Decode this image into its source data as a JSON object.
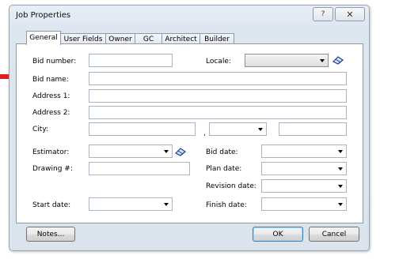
{
  "window": {
    "title": "Job Properties",
    "help_label": "?",
    "close_label": "✕"
  },
  "tabs": [
    {
      "label": "General",
      "active": true
    },
    {
      "label": "User Fields"
    },
    {
      "label": "Owner"
    },
    {
      "label": "GC"
    },
    {
      "label": "Architect"
    },
    {
      "label": "Builder"
    }
  ],
  "form": {
    "bid_number": {
      "label": "Bid number:",
      "value": ""
    },
    "locale": {
      "label": "Locale:",
      "value": ""
    },
    "bid_name": {
      "label": "Bid name:",
      "value": ""
    },
    "address1": {
      "label": "Address 1:",
      "value": ""
    },
    "address2": {
      "label": "Address 2:",
      "value": ""
    },
    "city": {
      "label": "City:",
      "value": "",
      "state": "",
      "zip": "",
      "separator": ","
    },
    "estimator": {
      "label": "Estimator:",
      "value": ""
    },
    "drawing": {
      "label": "Drawing #:",
      "value": ""
    },
    "bid_date": {
      "label": "Bid date:",
      "value": ""
    },
    "plan_date": {
      "label": "Plan date:",
      "value": ""
    },
    "revision_date": {
      "label": "Revision date:",
      "value": ""
    },
    "start_date": {
      "label": "Start date:",
      "value": ""
    },
    "finish_date": {
      "label": "Finish date:",
      "value": ""
    }
  },
  "buttons": {
    "notes": "Notes...",
    "ok": "OK",
    "cancel": "Cancel"
  },
  "colors": {
    "callout_arrow": "#e02020",
    "accent": "#3c7fb1"
  },
  "icons": {
    "eraser": "eraser-icon",
    "pointer": "red-arrow-pointer"
  }
}
